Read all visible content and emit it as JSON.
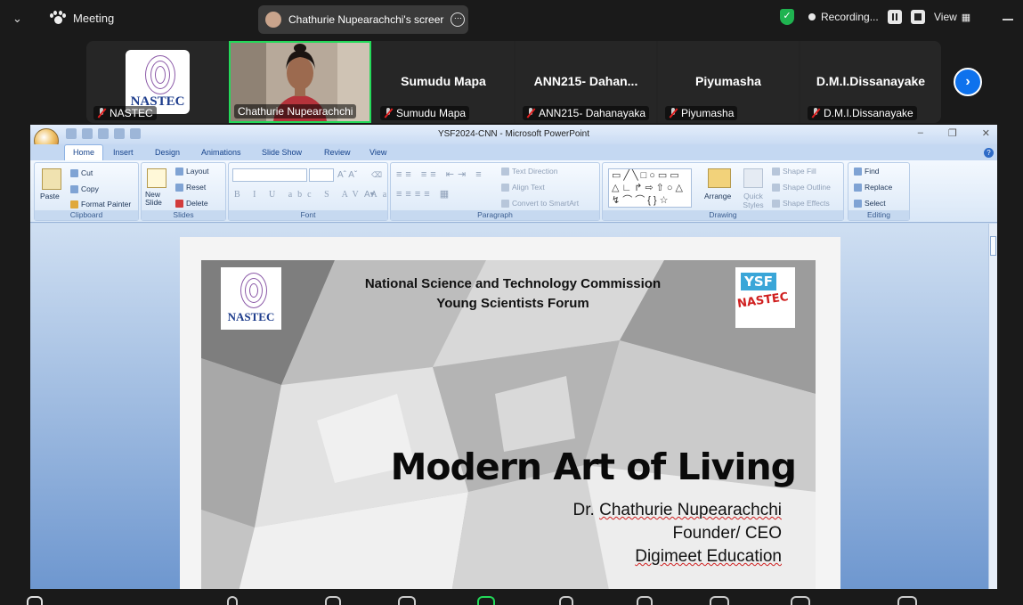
{
  "topbar": {
    "meeting_label": "Meeting",
    "share_label": "Chathurie Nupearachchi's screer",
    "recording_label": "Recording...",
    "view_label": "View"
  },
  "participants": [
    {
      "name": "NASTEC",
      "big_name": "",
      "has_logo": true
    },
    {
      "name": "Chathurie Nupearachchi",
      "big_name": "",
      "has_video": true
    },
    {
      "name": "Sumudu Mapa",
      "big_name": "Sumudu Mapa"
    },
    {
      "name": "ANN215- Dahanayaka",
      "big_name": "ANN215- Dahan..."
    },
    {
      "name": "Piyumasha",
      "big_name": "Piyumasha"
    },
    {
      "name": "D.M.I.Dissanayake",
      "big_name": "D.M.I.Dissanayake"
    }
  ],
  "powerpoint": {
    "window_title": "YSF2024-CNN - Microsoft PowerPoint",
    "tabs": [
      "Home",
      "Insert",
      "Design",
      "Animations",
      "Slide Show",
      "Review",
      "View"
    ],
    "active_tab": "Home",
    "groups": {
      "clipboard": {
        "label": "Clipboard",
        "paste": "Paste",
        "cut": "Cut",
        "copy": "Copy",
        "format_painter": "Format Painter"
      },
      "slides": {
        "label": "Slides",
        "new_slide": "New Slide",
        "layout": "Layout",
        "reset": "Reset",
        "delete": "Delete"
      },
      "font": {
        "label": "Font"
      },
      "paragraph": {
        "label": "Paragraph",
        "text_direction": "Text Direction",
        "align_text": "Align Text",
        "convert_smartart": "Convert to SmartArt"
      },
      "drawing": {
        "label": "Drawing",
        "arrange": "Arrange",
        "quick_styles": "Quick Styles",
        "shape_fill": "Shape Fill",
        "shape_outline": "Shape Outline",
        "shape_effects": "Shape Effects"
      },
      "editing": {
        "label": "Editing",
        "find": "Find",
        "replace": "Replace",
        "select": "Select"
      }
    }
  },
  "slide": {
    "org_line1": "National Science and Technology Commission",
    "org_line2": "Young Scientists Forum",
    "logo_left_text": "NASTEC",
    "logo_right_top": "YSF",
    "logo_right_bottom": "NASTEC",
    "title": "Modern Art of Living",
    "presenter": "Dr. Chathurie Nupearachchi",
    "role": "Founder/ CEO",
    "company": "Digimeet Education"
  },
  "colors": {
    "zoom_bg": "#1a1a1a",
    "accent_blue": "#0e72ed",
    "secure_green": "#1fb350",
    "active_speaker": "#23d959"
  }
}
